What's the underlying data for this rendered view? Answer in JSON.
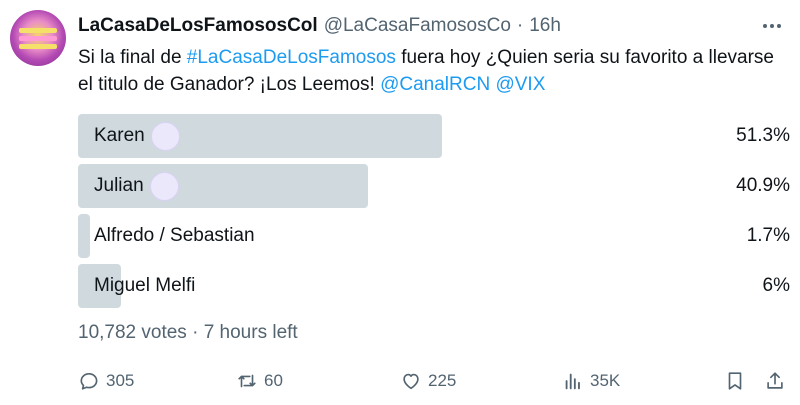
{
  "author": {
    "name": "LaCasaDeLosFamososCol",
    "handle": "@LaCasaFamososCo",
    "separator": "·",
    "time": "16h"
  },
  "tweet": {
    "text_1": "Si la final de ",
    "hashtag": "#LaCasaDeLosFamosos",
    "text_2": " fuera hoy ¿Quien seria su favorito a llevarse el titulo de Ganador?  ¡Los Leemos! ",
    "mention_1": "@CanalRCN",
    "mention_2": "@VIX"
  },
  "poll": {
    "options": [
      {
        "label": "Karen",
        "percent": "51.3%",
        "fraction": 0.513,
        "emoji": true
      },
      {
        "label": "Julian",
        "percent": "40.9%",
        "fraction": 0.409,
        "emoji": true
      },
      {
        "label": "Alfredo / Sebastian",
        "percent": "1.7%",
        "fraction": 0.017,
        "emoji": false
      },
      {
        "label": "Miguel Melfi",
        "percent": "6%",
        "fraction": 0.06,
        "emoji": false
      }
    ],
    "votes": "10,782 votes",
    "separator": "·",
    "time_left": "7 hours left"
  },
  "actions": {
    "reply_count": "305",
    "retweet_count": "60",
    "like_count": "225",
    "views_count": "35K"
  },
  "icons": [
    "more-icon",
    "reply-icon",
    "retweet-icon",
    "like-icon",
    "views-icon",
    "bookmark-icon",
    "share-icon"
  ],
  "colors": {
    "link": "#1d9bf0",
    "bar": "#cfd9de",
    "muted": "#536471",
    "text": "#0f1419"
  }
}
